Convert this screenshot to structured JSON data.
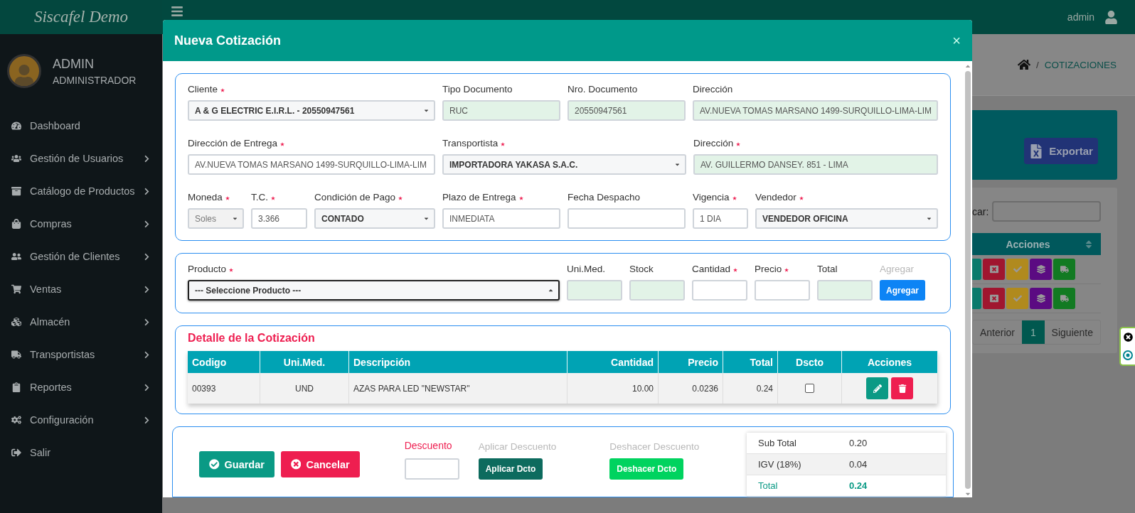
{
  "sidebar": {
    "brand": "Siscafel Demo",
    "user": {
      "name": "ADMIN",
      "role": "ADMINISTRADOR"
    },
    "items": [
      {
        "label": "Dashboard",
        "has_submenu": false
      },
      {
        "label": "Gestión de Usuarios",
        "has_submenu": true
      },
      {
        "label": "Catálogo de Productos",
        "has_submenu": true
      },
      {
        "label": "Compras",
        "has_submenu": true
      },
      {
        "label": "Gestión de Clientes",
        "has_submenu": true
      },
      {
        "label": "Ventas",
        "has_submenu": true
      },
      {
        "label": "Almacén",
        "has_submenu": true
      },
      {
        "label": "Transportistas",
        "has_submenu": true
      },
      {
        "label": "Reportes",
        "has_submenu": true
      },
      {
        "label": "Configuración",
        "has_submenu": true
      },
      {
        "label": "Salir",
        "has_submenu": false
      }
    ]
  },
  "topbar": {
    "user": "admin"
  },
  "background": {
    "breadcrumb_separator": "/",
    "breadcrumb": "COTIZACIONES",
    "export_button": "Exportar",
    "search_label": "car:",
    "table_header": "Acciones",
    "action_rows": [
      [
        {
          "kind": "edit",
          "color": "#0a7a6c"
        },
        {
          "kind": "cancel",
          "color": "#a0162f"
        },
        {
          "kind": "approve",
          "color": "#b08a1e"
        },
        {
          "kind": "layers",
          "color": "#5b0b82"
        },
        {
          "kind": "truck",
          "color": "#127a22"
        }
      ],
      [
        {
          "kind": "edit",
          "color": "#0a7a6c"
        },
        {
          "kind": "cancel",
          "color": "#a0162f"
        },
        {
          "kind": "approve",
          "color": "#b08a1e"
        },
        {
          "kind": "layers",
          "color": "#5b0b82"
        },
        {
          "kind": "truck",
          "color": "#127a22"
        }
      ]
    ],
    "pagination": [
      {
        "label": "Anterior",
        "selected": false
      },
      {
        "label": "1",
        "selected": true
      },
      {
        "label": "Siguiente",
        "selected": false
      }
    ]
  },
  "modal": {
    "title": "Nueva Cotización",
    "close": "×",
    "form_rows": [
      [
        {
          "label": "Cliente",
          "required": true,
          "kind": "select",
          "value": "A & G ELECTRIC E.I.R.L. - 20550947561",
          "readonly": false,
          "disabled": false,
          "focused": false
        },
        {
          "label": "Tipo Documento",
          "required": false,
          "kind": "text",
          "value": "RUC",
          "readonly": true,
          "disabled": false,
          "focused": false
        },
        {
          "label": "Nro. Documento",
          "required": false,
          "kind": "text",
          "value": "20550947561",
          "readonly": true,
          "disabled": false,
          "focused": false
        },
        {
          "label": "Dirección",
          "required": false,
          "kind": "text",
          "value": "AV.NUEVA TOMAS MARSANO 1499-SURQUILLO-LIMA-LIM",
          "readonly": true,
          "disabled": false,
          "focused": false
        }
      ],
      [
        {
          "label": "Dirección de Entrega",
          "required": true,
          "kind": "text",
          "value": "AV.NUEVA TOMAS MARSANO 1499-SURQUILLO-LIMA-LIM",
          "readonly": false,
          "disabled": false,
          "focused": false
        },
        {
          "label": "Transportista",
          "required": true,
          "kind": "select",
          "value": "IMPORTADORA YAKASA S.A.C.",
          "readonly": false,
          "disabled": false,
          "focused": false
        },
        {
          "label": "Dirección",
          "required": true,
          "kind": "text",
          "value": "AV. GUILLERMO DANSEY. 851 - LIMA",
          "readonly": true,
          "disabled": false,
          "focused": false
        }
      ],
      [
        {
          "label": "Moneda",
          "required": true,
          "kind": "select",
          "value": "Soles",
          "readonly": false,
          "disabled": true,
          "focused": false
        },
        {
          "label": "T.C.",
          "required": true,
          "kind": "text",
          "value": "3.366",
          "readonly": false,
          "disabled": false,
          "focused": false
        },
        {
          "label": "Condición de Pago",
          "required": true,
          "kind": "select",
          "value": "CONTADO",
          "readonly": false,
          "disabled": false,
          "focused": false
        },
        {
          "label": "Plazo de Entrega",
          "required": true,
          "kind": "text",
          "value": "INMEDIATA",
          "readonly": false,
          "disabled": false,
          "focused": false
        },
        {
          "label": "Fecha Despacho",
          "required": false,
          "kind": "text",
          "readonly": false,
          "disabled": false,
          "focused": false
        },
        {
          "label": "Vigencia",
          "required": true,
          "kind": "text",
          "value": "1 DIA",
          "readonly": false,
          "disabled": false,
          "focused": false
        },
        {
          "label": "Vendedor",
          "required": true,
          "kind": "select",
          "value": "VENDEDOR OFICINA",
          "readonly": false,
          "disabled": false,
          "focused": false
        }
      ]
    ],
    "product_row": [
      {
        "label": "Producto",
        "required": true,
        "kind": "select",
        "value": "--- Seleccione Producto ---",
        "readonly": false,
        "disabled": false,
        "focused": true
      },
      {
        "label": "Uni.Med.",
        "required": false,
        "kind": "text",
        "readonly": true,
        "disabled": false,
        "focused": false
      },
      {
        "label": "Stock",
        "required": false,
        "kind": "text",
        "readonly": true,
        "disabled": false,
        "focused": false
      },
      {
        "label": "Cantidad",
        "required": true,
        "kind": "text",
        "readonly": false,
        "disabled": false,
        "focused": false
      },
      {
        "label": "Precio",
        "required": true,
        "kind": "text",
        "readonly": false,
        "disabled": false,
        "focused": false
      },
      {
        "label": "Total",
        "required": false,
        "kind": "text",
        "readonly": true,
        "disabled": false,
        "focused": false
      },
      {
        "label": "Agregar",
        "required": false,
        "kind": "button",
        "value": "Agregar",
        "readonly": false,
        "disabled": false,
        "focused": false
      }
    ],
    "detail": {
      "title": "Detalle de la Cotización",
      "columns": [
        "Codigo",
        "Uni.Med.",
        "Descripción",
        "Cantidad",
        "Precio",
        "Total",
        "Dscto",
        "Acciones"
      ],
      "rows": [
        {
          "cells": [
            "00393",
            "UND",
            "AZAS PARA LED \"NEWSTAR\"",
            "10.00",
            "0.0236",
            "0.24"
          ],
          "dscto": false
        }
      ]
    },
    "footer": {
      "save": "Guardar",
      "cancel": "Cancelar",
      "discount_label": "Descuento",
      "apply_label": "Aplicar Descuento",
      "apply_button": "Aplicar Dcto",
      "undo_label": "Deshacer Descuento",
      "undo_button": "Deshacer Dcto",
      "totals": [
        {
          "kind": "sub",
          "label": "Sub Total",
          "value": "0.20"
        },
        {
          "kind": "tax",
          "label": "IGV (18%)",
          "value": "0.04"
        },
        {
          "kind": "total",
          "label": "Total",
          "value": "0.24"
        }
      ]
    }
  }
}
